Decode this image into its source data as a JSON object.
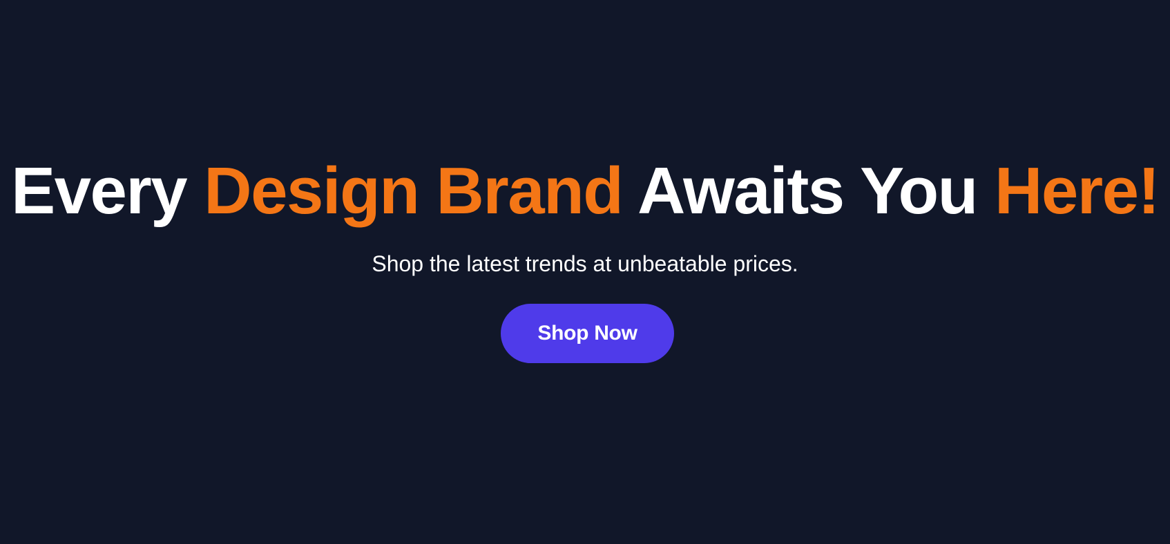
{
  "colors": {
    "background": "#111729",
    "accent": "#f47616",
    "button": "#4f3bea",
    "text": "#ffffff"
  },
  "hero": {
    "headline": {
      "part1": "Every ",
      "part2": "Design Brand",
      "part3": " Awaits You ",
      "part4": "Here!"
    },
    "subtitle": "Shop the latest trends at unbeatable prices.",
    "cta_label": "Shop Now"
  }
}
